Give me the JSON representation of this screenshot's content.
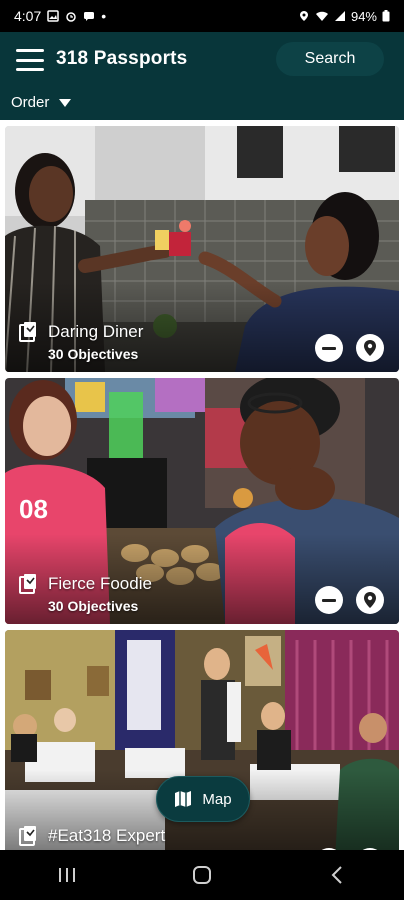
{
  "status_bar": {
    "time": "4:07",
    "battery": "94%",
    "dot": "•"
  },
  "header": {
    "title": "318 Passports",
    "search_label": "Search",
    "order_label": "Order"
  },
  "passports": [
    {
      "title": "Daring Diner",
      "objectives": "30 Objectives"
    },
    {
      "title": "Fierce Foodie",
      "objectives": "30 Objectives"
    },
    {
      "title": "#Eat318 Expert",
      "objectives": ""
    }
  ],
  "map_button": {
    "label": "Map"
  },
  "colors": {
    "header_bg": "#08363a",
    "fab_bg": "#0a3b3f",
    "accent_pink": "#e8456b"
  },
  "icons": {
    "menu": "hamburger-icon",
    "order": "caret-down-icon",
    "card_badge": "passport-icon",
    "remove": "minus-icon",
    "location": "location-pin-icon",
    "map": "map-icon"
  }
}
